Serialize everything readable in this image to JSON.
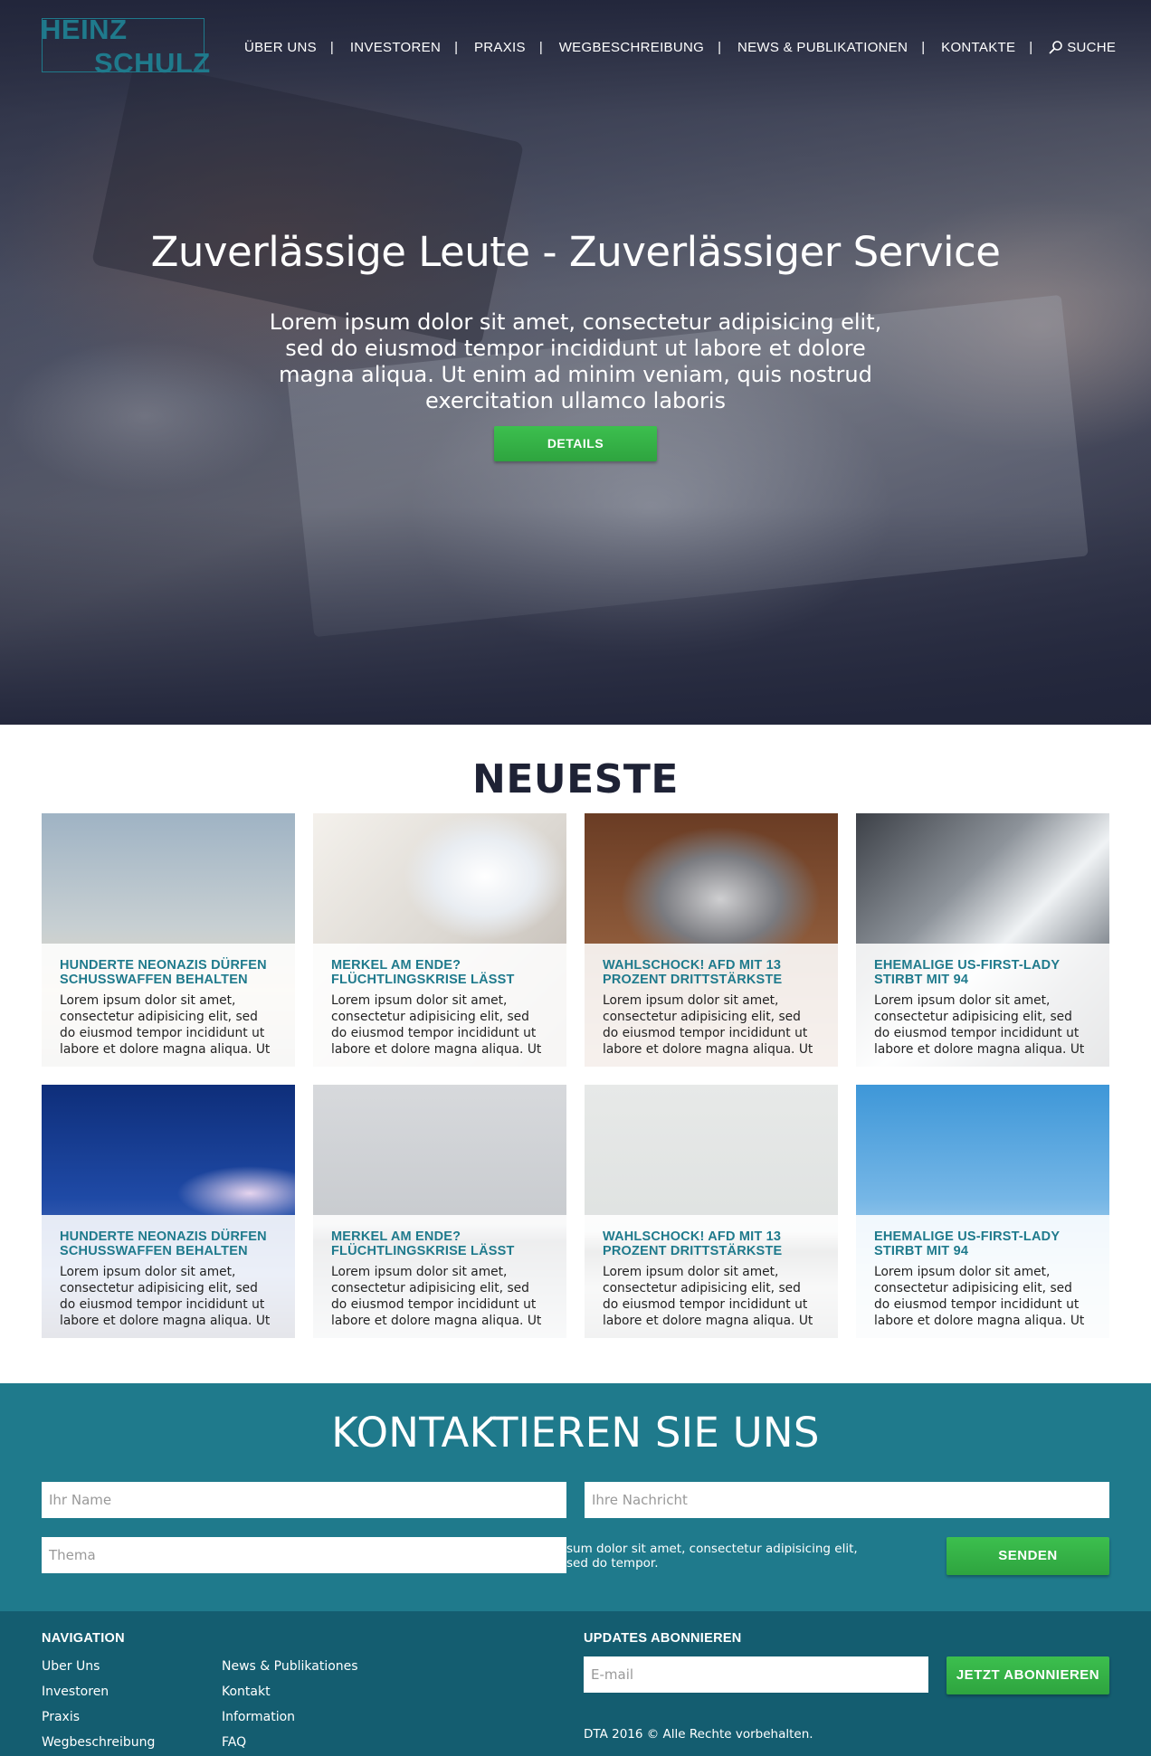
{
  "brand": {
    "line1": "HEINZ",
    "line2": "SCHULZ",
    "color": "#1f7a8c"
  },
  "nav": {
    "items": [
      "ÜBER UNS",
      "INVESTOREN",
      "PRAXIS",
      "WEGBESCHREIBUNG",
      "NEWS & PUBLIKATIONEN",
      "KONTAKTE"
    ],
    "search_label": "SUCHE",
    "separator": "|"
  },
  "hero": {
    "title": "Zuverlässige Leute - Zuverlässiger Service",
    "text": "Lorem ipsum dolor sit amet, consectetur adipisicing elit, sed do eiusmod tempor incididunt ut labore et dolore magna aliqua. Ut enim ad minim veniam, quis nostrud exercitation ullamco laboris",
    "button": "DETAILS"
  },
  "latest": {
    "title": "NEUESTE",
    "cards": [
      {
        "title": "HUNDERTE NEONAZIS DÜRFEN SCHUSSWAFFEN BEHALTEN",
        "text": "Lorem ipsum dolor sit amet, consectetur adipisicing elit, sed do eiusmod tempor incididunt ut labore et dolore magna aliqua. Ut",
        "image": "ferris-wheel"
      },
      {
        "title": "MERKEL AM ENDE? FLÜCHTLINGSKRISE LÄSST",
        "text": "Lorem ipsum dolor sit amet, consectetur adipisicing elit, sed do eiusmod tempor incididunt ut labore et dolore magna aliqua. Ut",
        "image": "laptop-analytics"
      },
      {
        "title": "WAHLSCHOCK! AFD MIT 13 PROZENT DRITTSTÄRKSTE",
        "text": "Lorem ipsum dolor sit amet, consectetur adipisicing elit, sed do eiusmod tempor incididunt ut labore et dolore magna aliqua. Ut",
        "image": "laptop-desk"
      },
      {
        "title": "EHEMALIGE US-FIRST-LADY STIRBT MIT 94",
        "text": "Lorem ipsum dolor sit amet, consectetur adipisicing elit, sed do eiusmod tempor incididunt ut labore et dolore magna aliqua. Ut",
        "image": "skyscrapers"
      },
      {
        "title": "HUNDERTE NEONAZIS DÜRFEN SCHUSSWAFFEN BEHALTEN",
        "text": "Lorem ipsum dolor sit amet, consectetur adipisicing elit, sed do eiusmod tempor incididunt ut labore et dolore magna aliqua. Ut",
        "image": "blue-sky-city"
      },
      {
        "title": "MERKEL AM ENDE? FLÜCHTLINGSKRISE LÄSST",
        "text": "Lorem ipsum dolor sit amet, consectetur adipisicing elit, sed do eiusmod tempor incididunt ut labore et dolore magna aliqua. Ut",
        "image": "cloudy-city"
      },
      {
        "title": "WAHLSCHOCK! AFD MIT 13 PROZENT DRITTSTÄRKSTE",
        "text": "Lorem ipsum dolor sit amet, consectetur adipisicing elit, sed do eiusmod tempor incididunt ut labore et dolore magna aliqua. Ut",
        "image": "harbor-boats"
      },
      {
        "title": "EHEMALIGE US-FIRST-LADY STIRBT MIT 94",
        "text": "Lorem ipsum dolor sit amet, consectetur adipisicing elit, sed do eiusmod tempor incididunt ut labore et dolore magna aliqua. Ut",
        "image": "clear-sky"
      }
    ]
  },
  "contact": {
    "title": "KONTAKTIEREN SIE UNS",
    "name_placeholder": "Ihr Name",
    "message_placeholder": "Ihre Nachricht",
    "subject_placeholder": "Thema",
    "note": "sum dolor sit amet, consectetur adipisicing elit, sed do tempor.",
    "send_button": "SENDEN",
    "background": "#1f7a8c"
  },
  "footer": {
    "nav_title": "NAVIGATION",
    "col1": [
      "Uber Uns",
      "Investoren",
      "Praxis",
      "Wegbeschreibung"
    ],
    "col2": [
      "News & Publikationes",
      "Kontakt",
      "Information",
      "FAQ"
    ],
    "subscribe_title": "UPDATES ABONNIEREN",
    "email_placeholder": "E-mail",
    "subscribe_button": "JETZT ABONNIEREN",
    "copyright": "DTA 2016 © Alle Rechte vorbehalten.",
    "background": "#145d70"
  },
  "colors": {
    "accent": "#1f7a8c",
    "button_green": "#34b046",
    "dark_navy": "#21253a"
  }
}
